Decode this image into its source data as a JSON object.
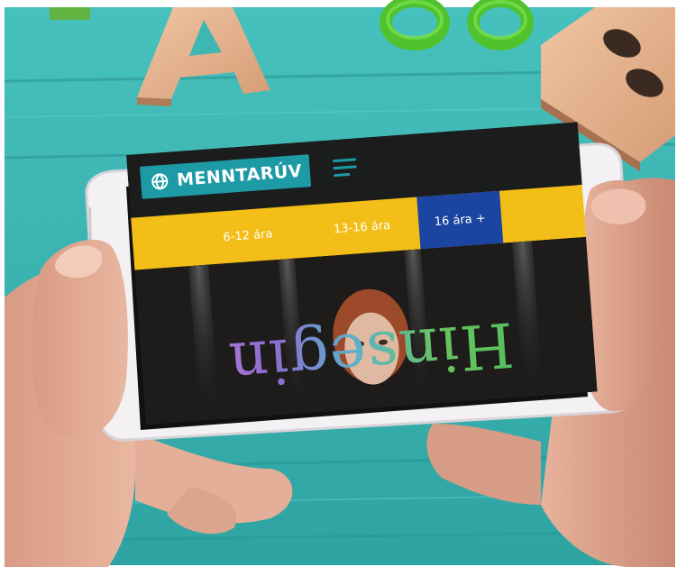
{
  "colors": {
    "wood_table": "#3eb7b3",
    "phone_bar": "#1b1d1c",
    "logo_bg": "#1d9aa6",
    "age_bar": "#f2be17",
    "active_tab": "#1b45a0"
  },
  "header": {
    "logo_text": "MENNTARÚV",
    "logo_icon": "globe-icon",
    "menu_icon": "hamburger-menu-icon"
  },
  "age_tabs": [
    {
      "label": "6-12 ára",
      "active": false
    },
    {
      "label": "13-16 ára",
      "active": false
    },
    {
      "label": "16 ára +",
      "active": true
    }
  ],
  "hero": {
    "title": "Hinsegin"
  },
  "background_letters": [
    "A",
    "B"
  ]
}
